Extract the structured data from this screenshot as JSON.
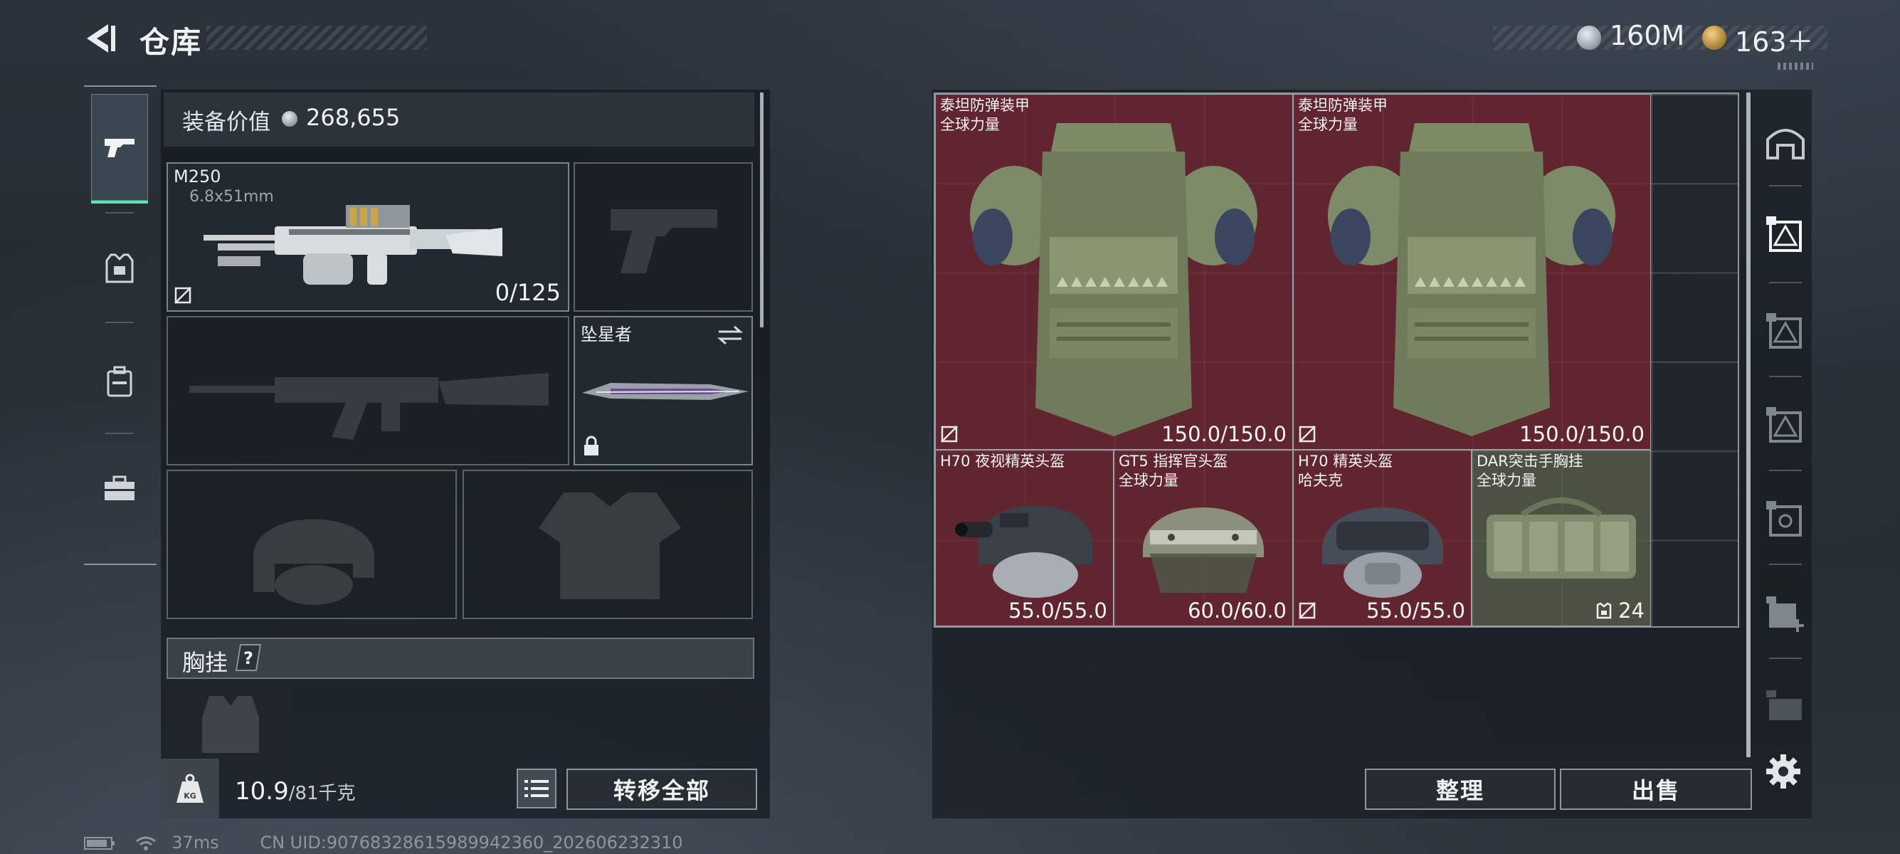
{
  "header": {
    "title": "仓库"
  },
  "currency": [
    {
      "icon": "silver-coin-icon",
      "value": "160M"
    },
    {
      "icon": "gold-coin-icon",
      "value": "163＋"
    }
  ],
  "left_rail": [
    {
      "icon": "pistol-icon",
      "active": true
    },
    {
      "icon": "armor-vest-icon",
      "active": false
    },
    {
      "icon": "backpack-icon",
      "active": false
    },
    {
      "icon": "toolbox-icon",
      "active": false
    }
  ],
  "equipment": {
    "label": "装备价值",
    "value": "268,655",
    "primary_weapon": {
      "name": "M250",
      "caliber": "6.8x51mm",
      "ammo": "0/125"
    },
    "melee": {
      "name": "坠星者"
    },
    "chest_rig_label": "胸挂",
    "help": "?"
  },
  "footer_left": {
    "kg_icon": "KG",
    "weight_current": "10.9",
    "weight_max": "/81千克",
    "transfer_all": "转移全部"
  },
  "status_bar": {
    "ping": "37ms",
    "uid": "CN UID:90768328615989942360_202606232310"
  },
  "storage_items": [
    {
      "name": "泰坦防弹装甲",
      "sub": "全球力量",
      "durability": "150.0/150.0",
      "type": "armor"
    },
    {
      "name": "泰坦防弹装甲",
      "sub": "全球力量",
      "durability": "150.0/150.0",
      "type": "armor"
    },
    {
      "name": "H70 夜视精英头盔",
      "sub": "",
      "durability": "55.0/55.0",
      "type": "helmet-nv"
    },
    {
      "name": "GT5 指挥官头盔",
      "sub": "全球力量",
      "durability": "60.0/60.0",
      "type": "helmet-visor"
    },
    {
      "name": "H70 精英头盔",
      "sub": "哈夫克",
      "durability": "55.0/55.0",
      "type": "helmet-mask"
    },
    {
      "name": "DAR突击手胸挂",
      "sub": "全球力量",
      "durability": "24",
      "type": "chest-rig"
    }
  ],
  "footer_right": {
    "sort": "整理",
    "sell": "出售"
  },
  "right_tabs": [
    {
      "icon": "storage-all-icon",
      "active": false
    },
    {
      "icon": "storage-tab-1-icon",
      "active": true
    },
    {
      "icon": "storage-tab-2-icon",
      "active": false
    },
    {
      "icon": "storage-tab-3-icon",
      "active": false
    },
    {
      "icon": "storage-tab-4-icon",
      "active": false
    },
    {
      "icon": "storage-tab-add-icon",
      "active": false
    },
    {
      "icon": "storage-tab-locked-icon",
      "active": false
    }
  ],
  "colors": {
    "accent_green": "#5de2b6",
    "item_red": "#78262f",
    "item_olive": "#5c644e"
  }
}
